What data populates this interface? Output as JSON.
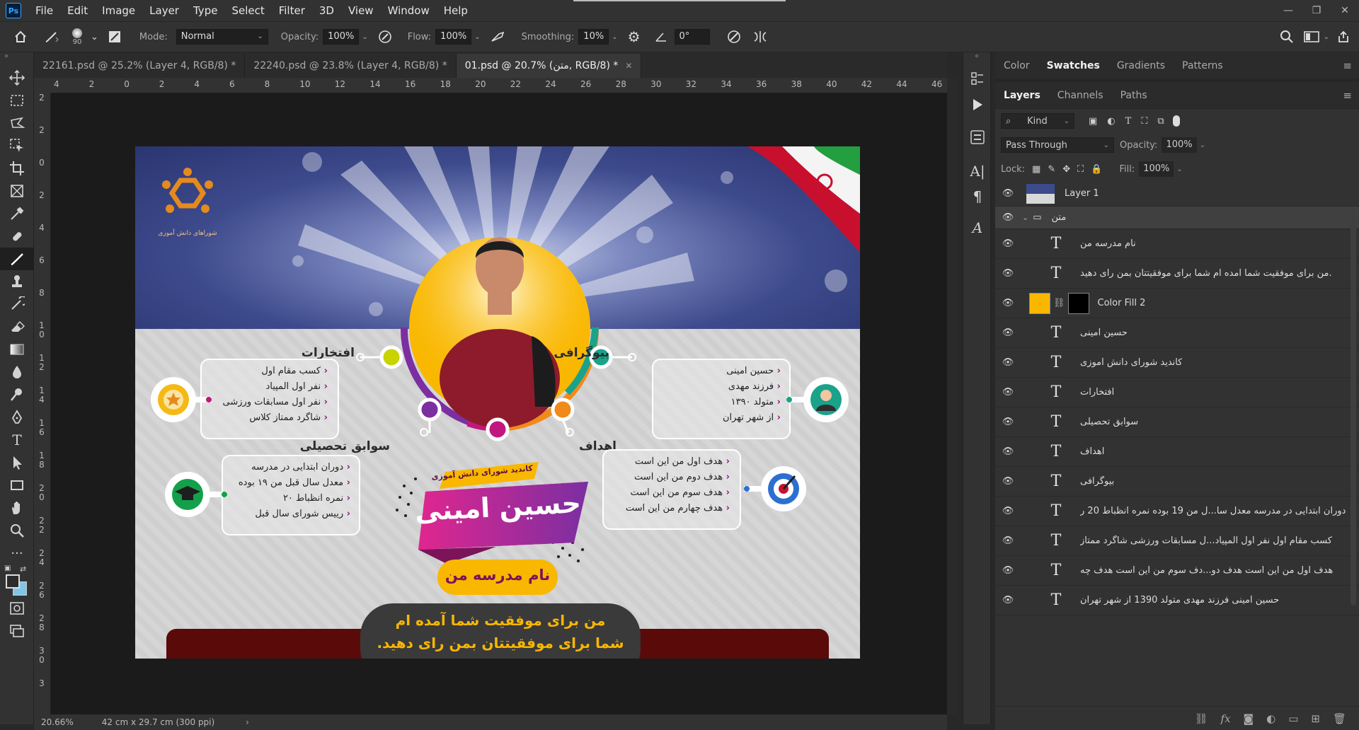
{
  "app": {
    "logo_text": "Ps"
  },
  "menu": [
    "File",
    "Edit",
    "Image",
    "Layer",
    "Type",
    "Select",
    "Filter",
    "3D",
    "View",
    "Window",
    "Help"
  ],
  "window_controls": {
    "minimize": "—",
    "restore": "❐",
    "close": "✕"
  },
  "options_bar": {
    "brush_size": "90",
    "mode_label": "Mode:",
    "mode_value": "Normal",
    "opacity_label": "Opacity:",
    "opacity_value": "100%",
    "flow_label": "Flow:",
    "flow_value": "100%",
    "smoothing_label": "Smoothing:",
    "smoothing_value": "10%",
    "angle_value": "0°"
  },
  "tabs": [
    {
      "label": "22161.psd @ 25.2% (Layer 4, RGB/8) *",
      "active": false
    },
    {
      "label": "22240.psd @ 23.8% (Layer 4, RGB/8) *",
      "active": false
    },
    {
      "label": "01.psd @ 20.7% (متن, RGB/8) *",
      "active": true
    }
  ],
  "ruler_top": [
    "4",
    "2",
    "0",
    "2",
    "4",
    "6",
    "8",
    "10",
    "12",
    "14",
    "16",
    "18",
    "20",
    "22",
    "24",
    "26",
    "28",
    "30",
    "32",
    "34",
    "36",
    "38",
    "40",
    "42",
    "44",
    "46"
  ],
  "ruler_left": [
    "2",
    "2",
    "0",
    "2",
    "4",
    "6",
    "8",
    "1 0",
    "1 2",
    "1 4",
    "1 6",
    "1 8",
    "2 0",
    "2 2",
    "2 4",
    "2 6",
    "2 8",
    "3 0",
    "3"
  ],
  "status": {
    "zoom": "20.66%",
    "doc_info": "42 cm x 29.7 cm (300 ppi)"
  },
  "artwork": {
    "logo_caption": "شوراهای دانش آموزی",
    "achievements_title": "افتخارات",
    "achievements": [
      "کسب مقام اول",
      "نفر اول المپیاد",
      "نفر اول مسابقات ورزشی",
      "شاگرد ممتاز کلاس"
    ],
    "bio_title": "بیوگرافی",
    "bio": [
      "حسین امینی",
      "فرزند مهدی",
      "متولد ۱۳۹۰",
      "از شهر تهران"
    ],
    "history_title": "سوابق تحصیلی",
    "history": [
      "دوران ابتدایی در مدرسه",
      "معدل سال قبل من ۱۹ بوده",
      "نمره انظباط ۲۰",
      "رییس شورای سال قبل"
    ],
    "goals_title": "اهداف",
    "goals": [
      "هدف اول من این است",
      "هدف دوم من این است",
      "هدف سوم من این است",
      "هدف چهارم من این است"
    ],
    "candidate_tag": "کاندید شورای دانش آموزی",
    "name": "حسین امینی",
    "school": "نام مدرسه من",
    "slogan_1": "من برای موفقیت شما آمده ام",
    "slogan_2": "شما برای موفقیتتان بمن رای دهید."
  },
  "right_tabs_top": [
    {
      "label": "Color",
      "active": false
    },
    {
      "label": "Swatches",
      "active": true
    },
    {
      "label": "Gradients",
      "active": false
    },
    {
      "label": "Patterns",
      "active": false
    }
  ],
  "right_tabs_layers": [
    {
      "label": "Layers",
      "active": true
    },
    {
      "label": "Channels",
      "active": false
    },
    {
      "label": "Paths",
      "active": false
    }
  ],
  "layers_panel": {
    "filter_kind": "Kind",
    "blend_mode": "Pass Through",
    "opacity_label": "Opacity:",
    "opacity_value": "100%",
    "lock_label": "Lock:",
    "fill_label": "Fill:",
    "fill_value": "100%"
  },
  "layers": [
    {
      "name": "Layer 1",
      "kind": "image"
    },
    {
      "name": "متن",
      "kind": "group"
    },
    {
      "name": "نام مدرسه من",
      "kind": "text"
    },
    {
      "name": "من برای موفقیت شما آمده ام شما برای موفقیتتان بمن رای دهید.",
      "kind": "text"
    },
    {
      "name": "Color Fill 2",
      "kind": "fill"
    },
    {
      "name": "حسین امینی",
      "kind": "text"
    },
    {
      "name": "کاندید شورای دانش آموزی",
      "kind": "text"
    },
    {
      "name": "افتخارات",
      "kind": "text"
    },
    {
      "name": "سوابق تحصیلی",
      "kind": "text"
    },
    {
      "name": "اهداف",
      "kind": "text"
    },
    {
      "name": "بیوگرافی",
      "kind": "text"
    },
    {
      "name": "دوران ابتدایی در مدرسه معدل سا...ل من 19 بوده نمره انظباط 20 ر",
      "kind": "text"
    },
    {
      "name": "کسب مقام اول  نفر اول المپیاد...ل مسابقات ورزشی شاگرد ممتاز",
      "kind": "text"
    },
    {
      "name": "هدف اول من این است هدف دو...دف سوم من این است هدف چه",
      "kind": "text"
    },
    {
      "name": "حسین امینی فرزند مهدی متولد 1390 از شهر تهران",
      "kind": "text"
    }
  ],
  "colors": {
    "fill_swatch": "#f9b700",
    "accent_magenta": "#c2177e",
    "accent_purple": "#7b2fa1"
  }
}
